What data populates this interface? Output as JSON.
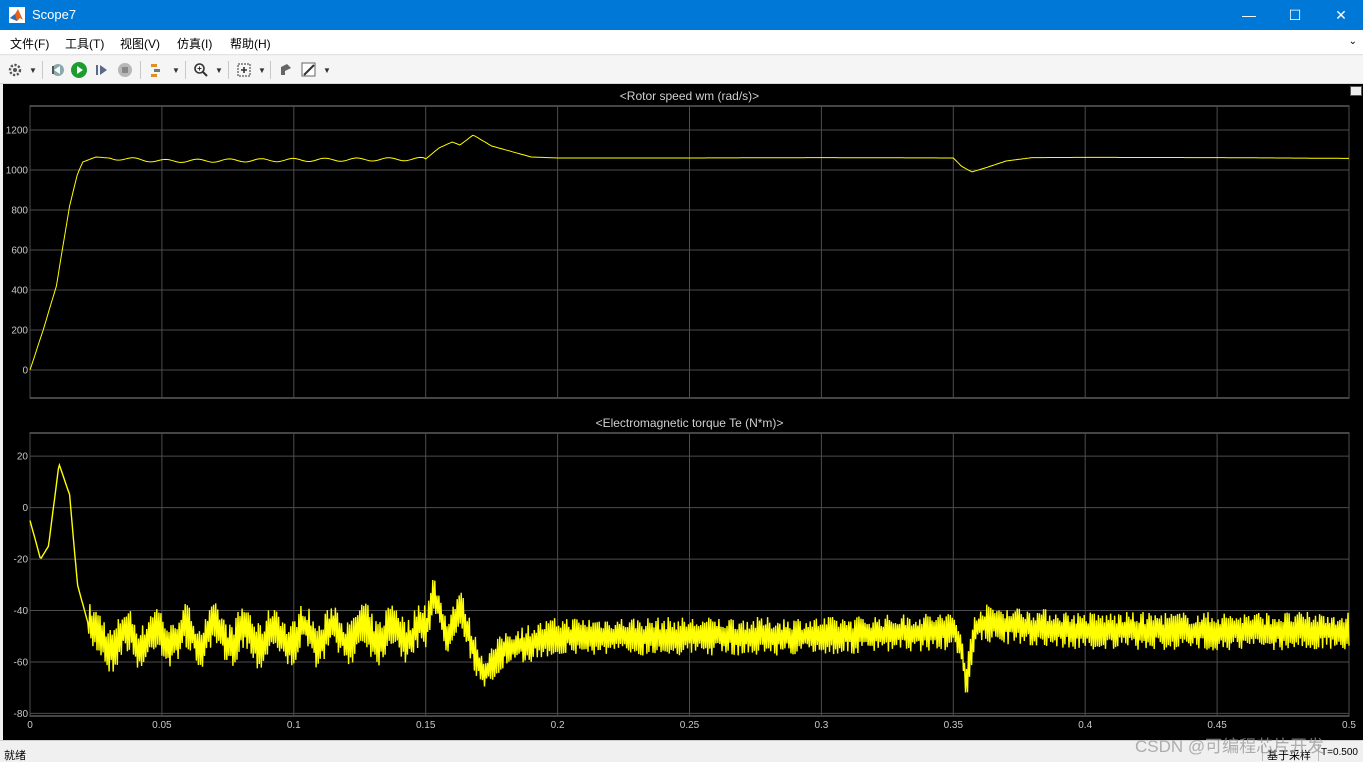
{
  "window": {
    "title": "Scope7",
    "minimize": "—",
    "maximize": "☐",
    "close": "✕"
  },
  "menu": [
    "文件(F)",
    "工具(T)",
    "视图(V)",
    "仿真(I)",
    "帮助(H)"
  ],
  "toolbar": {
    "icons": [
      "gear-icon",
      "step-back-icon",
      "run-icon",
      "step-forward-icon",
      "stop-icon",
      "signal-select-icon",
      "zoom-icon",
      "autoscale-icon",
      "highlight-icon",
      "style-icon"
    ]
  },
  "plots": [
    {
      "title": "<Rotor speed wm (rad/s)>",
      "ylim": [
        -140,
        1320
      ],
      "yticks": [
        0,
        200,
        400,
        600,
        800,
        1000,
        1200
      ],
      "ytick_labels": [
        "0",
        "200",
        "400",
        "600",
        "800",
        "1000",
        "1200"
      ],
      "show_xtick_labels": false
    },
    {
      "title": "<Electromagnetic torque Te (N*m)>",
      "ylim": [
        -81,
        29
      ],
      "yticks": [
        -80,
        -60,
        -40,
        -20,
        0,
        20
      ],
      "ytick_labels": [
        "-80",
        "-60",
        "-40",
        "-20",
        "0",
        "20"
      ],
      "show_xtick_labels": true
    }
  ],
  "xaxis": {
    "xlim": [
      0,
      0.5
    ],
    "ticks": [
      0,
      0.05,
      0.1,
      0.15,
      0.2,
      0.25,
      0.3,
      0.35,
      0.4,
      0.45,
      0.5
    ],
    "labels": [
      "0",
      "0.05",
      "0.1",
      "0.15",
      "0.2",
      "0.25",
      "0.3",
      "0.35",
      "0.4",
      "0.45",
      "0.5"
    ]
  },
  "chart_data": [
    {
      "type": "line",
      "title": "<Rotor speed wm (rad/s)>",
      "xlim": [
        0,
        0.5
      ],
      "ylim": [
        -140,
        1320
      ],
      "grid": true,
      "series": [
        {
          "color": "#ffff00",
          "x": [
            0,
            0.005,
            0.01,
            0.015,
            0.018,
            0.02,
            0.025,
            0.03,
            0.05,
            0.1,
            0.15,
            0.155,
            0.16,
            0.163,
            0.168,
            0.175,
            0.19,
            0.2,
            0.25,
            0.3,
            0.35,
            0.353,
            0.357,
            0.362,
            0.37,
            0.38,
            0.4,
            0.45,
            0.5
          ],
          "y": [
            0,
            200,
            420,
            820,
            980,
            1040,
            1065,
            1060,
            1045,
            1050,
            1055,
            1110,
            1140,
            1125,
            1175,
            1120,
            1065,
            1060,
            1060,
            1062,
            1060,
            1020,
            990,
            1010,
            1045,
            1062,
            1063,
            1062,
            1058
          ]
        }
      ]
    },
    {
      "type": "line",
      "title": "<Electromagnetic torque Te (N*m)>",
      "xlim": [
        0,
        0.5
      ],
      "ylim": [
        -81,
        29
      ],
      "grid": true,
      "series": [
        {
          "color": "#ffff00",
          "x": [
            0,
            0.004,
            0.007,
            0.011,
            0.015,
            0.018,
            0.022,
            0.025,
            0.05,
            0.1,
            0.15,
            0.153,
            0.158,
            0.163,
            0.168,
            0.172,
            0.18,
            0.2,
            0.25,
            0.3,
            0.35,
            0.353,
            0.355,
            0.358,
            0.362,
            0.4,
            0.45,
            0.5
          ],
          "y": [
            -5,
            -20,
            -15,
            17,
            5,
            -30,
            -45,
            -52,
            -50,
            -50,
            -48,
            -33,
            -50,
            -38,
            -55,
            -65,
            -55,
            -50,
            -50,
            -50,
            -48,
            -55,
            -68,
            -47,
            -45,
            -48,
            -48,
            -48
          ]
        }
      ]
    }
  ],
  "status": {
    "left": "就绪",
    "mode": "基于采样",
    "time": "T=0.500"
  },
  "watermark": "CSDN @可编程芯片开发"
}
